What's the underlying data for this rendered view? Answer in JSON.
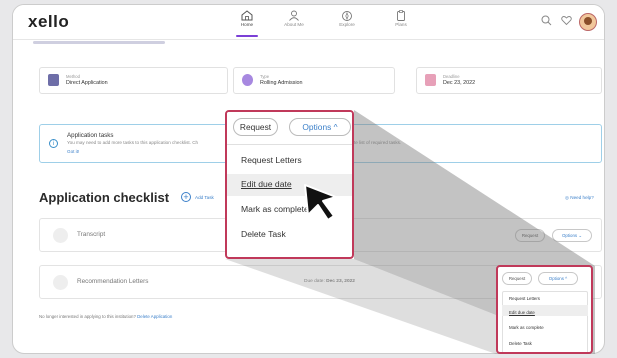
{
  "app": {
    "logo": "xello"
  },
  "nav": [
    {
      "label": "Home",
      "icon": "home-icon",
      "active": true
    },
    {
      "label": "About Me",
      "icon": "person-icon",
      "active": false
    },
    {
      "label": "Explore",
      "icon": "compass-icon",
      "active": false
    },
    {
      "label": "Plans",
      "icon": "clipboard-icon",
      "active": false
    }
  ],
  "meta": [
    {
      "key": "Method",
      "value": "Direct Application",
      "icon": "document-icon"
    },
    {
      "key": "Type",
      "value": "Rolling Admission",
      "icon": "badge-icon"
    },
    {
      "key": "Deadline",
      "value": "Dec 23, 2022",
      "icon": "calendar-icon"
    }
  ],
  "info": {
    "title": "Application tasks",
    "desc_left": "You may need to add more tasks to this application checklist. Ch",
    "desc_right": "mplete list of required tasks.",
    "link": "Got it!"
  },
  "checklist": {
    "title": "Application checklist",
    "add_task": "Add Task",
    "help": "Need help?"
  },
  "tasks": [
    {
      "name": "Transcript",
      "due": "",
      "request": "Request",
      "options": "Options"
    },
    {
      "name": "Recommendation Letters",
      "due_label": "Due date:",
      "due_value": "Dec 23, 2022",
      "request": "Request",
      "options": "Options"
    }
  ],
  "footer": {
    "text": "No longer interested in applying to this institution?",
    "link": "Delete Application"
  },
  "menu": {
    "request": "Request",
    "options": "Options",
    "items": [
      "Request Letters",
      "Edit due date",
      "Mark as complete",
      "Delete Task"
    ],
    "highlighted": 1
  },
  "colors": {
    "accent": "#3a7fc9",
    "highlight_border": "#c0395a",
    "nav_active": "#7b3fd6"
  }
}
